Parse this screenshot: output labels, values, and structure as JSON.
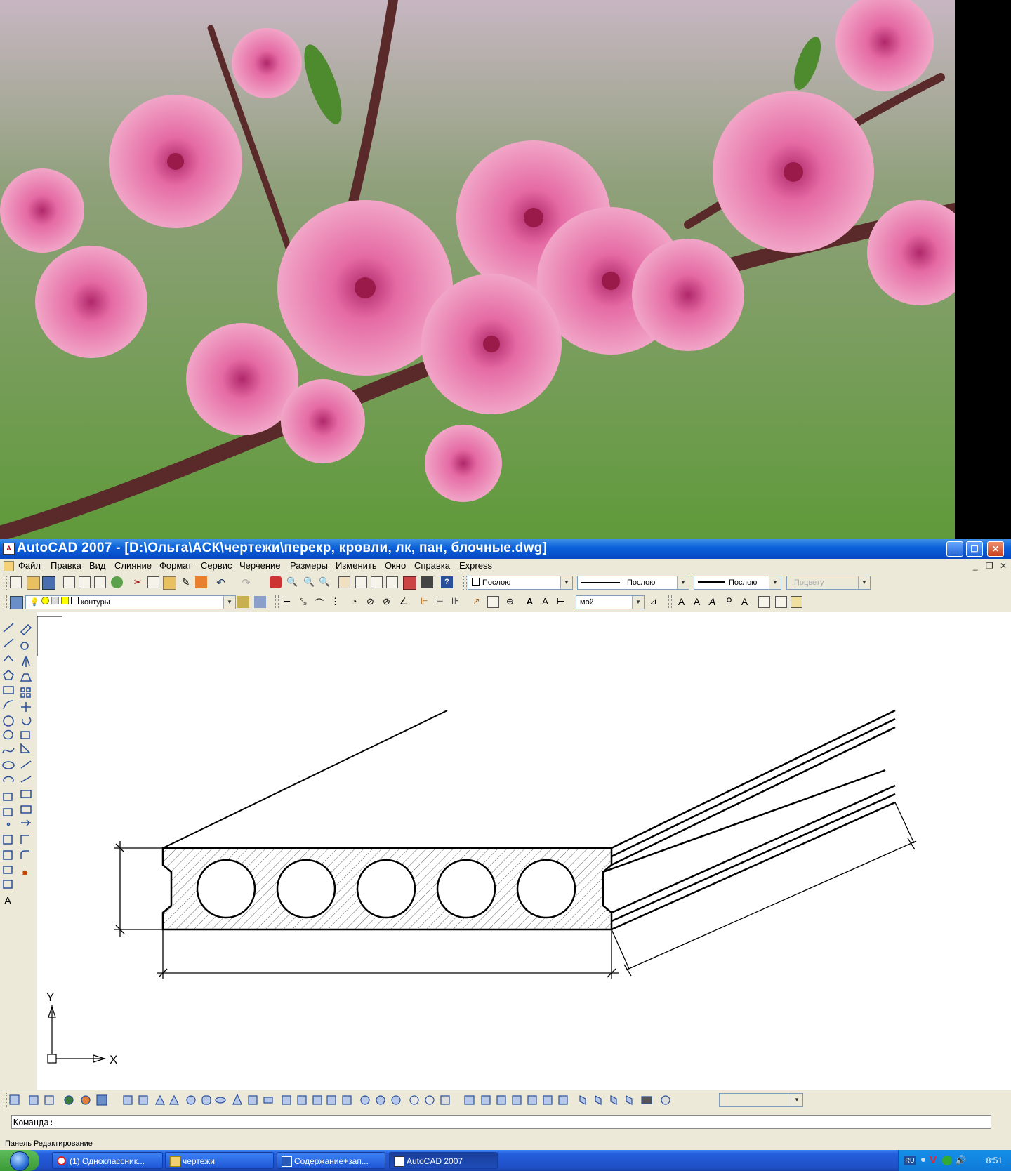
{
  "window": {
    "title": "AutoCAD 2007 - [D:\\Ольга\\АСК\\чертежи\\перекр, кровли, лк, пан, блочные.dwg]",
    "app_icon_label": "A"
  },
  "menu": [
    "Файл",
    "Правка",
    "Вид",
    "Слияние",
    "Формат",
    "Сервис",
    "Черчение",
    "Размеры",
    "Изменить",
    "Окно",
    "Справка",
    "Express"
  ],
  "toolbar": {
    "color_combo": "Послою",
    "linetype_combo": "Послою",
    "lineweight_combo": "Послою",
    "plotstyle_combo": "Поцвету",
    "layer_combo": "контуры",
    "dimstyle_combo": "мой"
  },
  "ucs": {
    "y_label": "Y",
    "x_label": "X"
  },
  "command": {
    "prompt": "Команда:"
  },
  "status": {
    "text": "Панель Редактирование"
  },
  "taskbar": {
    "tasks": [
      "(1) Одноклассник...",
      "чертежи",
      "Содержание+зап...",
      "AutoCAD 2007"
    ],
    "clock": "8:51",
    "tray_badge": "RU"
  },
  "colors": {
    "title_blue": "#0a5fd9",
    "taskbar_blue": "#245edb",
    "start_green": "#3a9a36",
    "toolbar_bg": "#ece9d8"
  }
}
